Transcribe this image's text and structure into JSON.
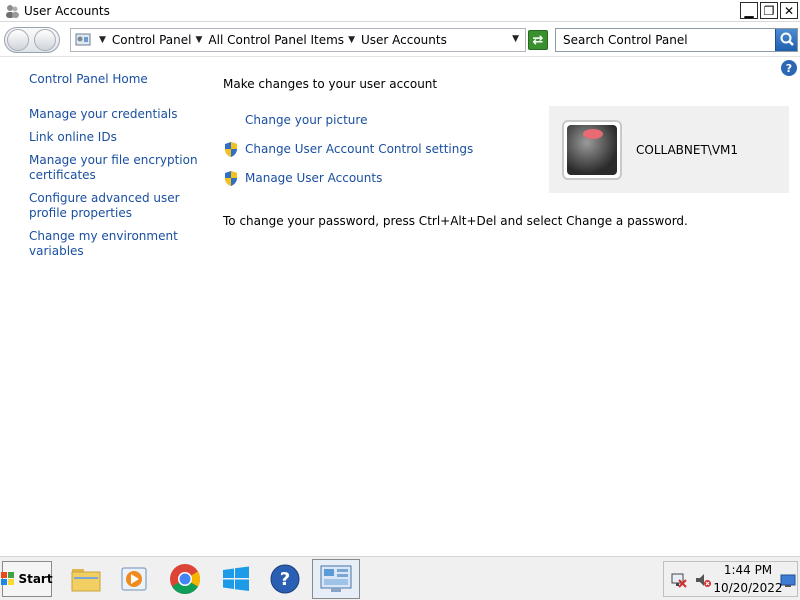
{
  "window": {
    "title": "User Accounts",
    "minimize": "▁",
    "restore": "❐",
    "close": "✕"
  },
  "address": {
    "crumbs": [
      "Control Panel",
      "All Control Panel Items",
      "User Accounts"
    ]
  },
  "search": {
    "placeholder": "Search Control Panel"
  },
  "help": "?",
  "left_pane": {
    "home": "Control Panel Home",
    "links": [
      "Manage your credentials",
      "Link online IDs",
      "Manage your file encryption certificates",
      "Configure advanced user profile properties",
      "Change my environment variables"
    ]
  },
  "main": {
    "heading": "Make changes to your user account",
    "tasks": [
      {
        "label": "Change your picture",
        "shield": false
      },
      {
        "label": "Change User Account Control settings",
        "shield": true
      },
      {
        "label": "Manage User Accounts",
        "shield": true
      }
    ],
    "password_note": "To change your password, press Ctrl+Alt+Del and select Change a password.",
    "user_name": "COLLABNET\\VM1"
  },
  "taskbar": {
    "start_label": "Start",
    "time": "1:44 PM",
    "date": "10/20/2022"
  },
  "colors": {
    "link": "#1a4fa0",
    "taskbar": "#f0f0f0"
  }
}
